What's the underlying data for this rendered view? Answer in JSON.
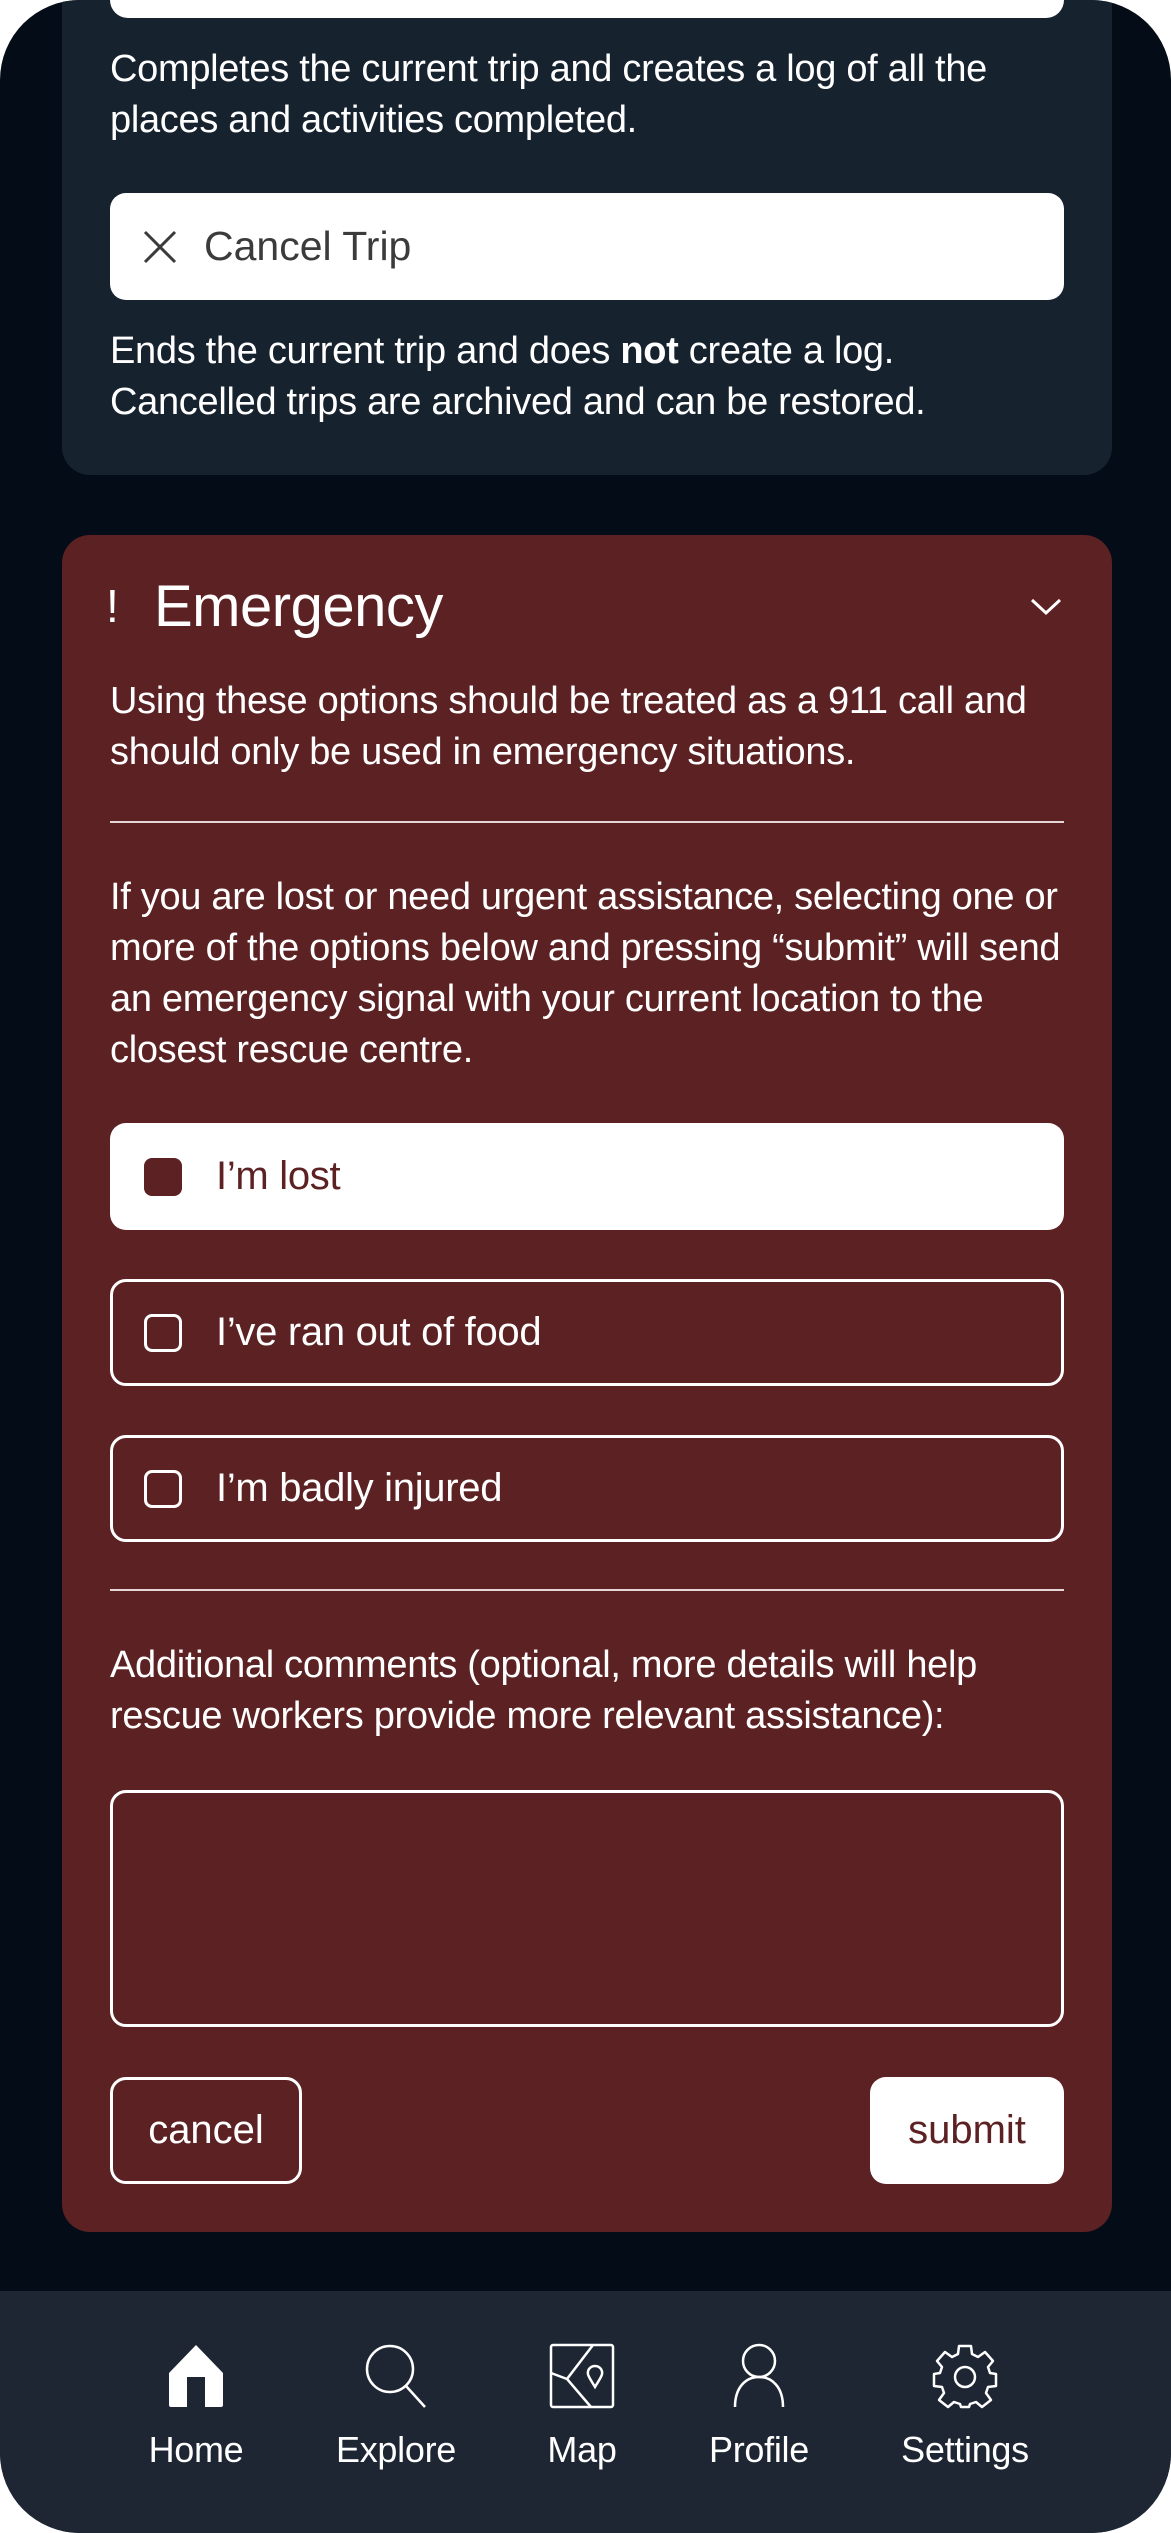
{
  "trip_actions": {
    "complete_description": "Completes the current trip and creates a log of all the places and activities completed.",
    "cancel_button_label": "Cancel Trip",
    "cancel_description_before": "Ends the current trip and does ",
    "cancel_description_bold": "not",
    "cancel_description_after": " create a log. Cancelled trips are archived and can be restored."
  },
  "emergency": {
    "icon": "exclamation-icon",
    "title": "Emergency",
    "expanded": true,
    "warning": "Using these options should be treated as a 911 call and should only be used in emergency situations.",
    "instructions": "If you are lost or need urgent assistance, selecting one or more of the options below and pressing “submit” will send an emergency signal with your current location to the closest rescue centre.",
    "options": [
      {
        "label": "I’m lost",
        "checked": true
      },
      {
        "label": "I’ve ran out of food",
        "checked": false
      },
      {
        "label": "I’m badly injured",
        "checked": false
      }
    ],
    "comments_label": "Additional comments (optional, more details will help rescue workers provide more relevant assistance):",
    "comments_value": "",
    "comments_placeholder": "",
    "cancel_label": "cancel",
    "submit_label": "submit"
  },
  "nav": {
    "items": [
      {
        "label": "Home",
        "icon": "home-icon",
        "active": true
      },
      {
        "label": "Explore",
        "icon": "search-icon",
        "active": false
      },
      {
        "label": "Map",
        "icon": "map-icon",
        "active": false
      },
      {
        "label": "Profile",
        "icon": "profile-icon",
        "active": false
      },
      {
        "label": "Settings",
        "icon": "gear-icon",
        "active": false
      }
    ]
  },
  "colors": {
    "background": "#040d17",
    "card": "#17222f",
    "emergency": "#5c2123",
    "nav": "#1e2633",
    "text": "#ffffff"
  }
}
